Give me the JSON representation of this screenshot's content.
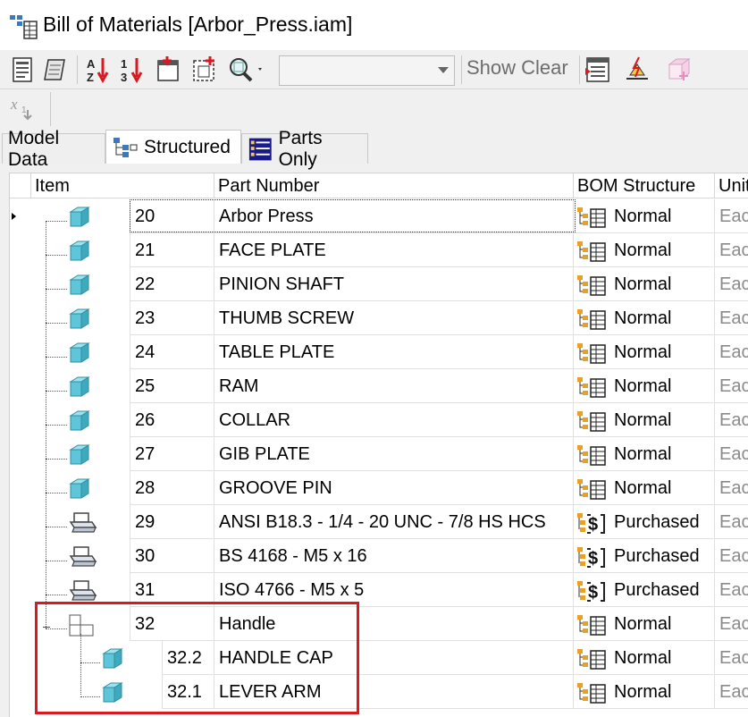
{
  "window": {
    "title": "Bill of Materials [Arbor_Press.iam]"
  },
  "toolbar": {
    "view_combo_value": "",
    "show_clear_label": "Show Clear"
  },
  "tabs": [
    {
      "label": "Model Data",
      "active": false
    },
    {
      "label": "Structured",
      "active": true
    },
    {
      "label": "Parts Only",
      "active": false
    }
  ],
  "grid": {
    "columns": {
      "item": "Item",
      "part_number": "Part Number",
      "bom_structure": "BOM Structure",
      "unit": "Unit"
    },
    "rows": [
      {
        "item": "20",
        "part_number": "Arbor Press",
        "bom": "Normal",
        "unit": "Each",
        "icon": "part-icon",
        "level": 0
      },
      {
        "item": "21",
        "part_number": "FACE PLATE",
        "bom": "Normal",
        "unit": "Each",
        "icon": "part-icon",
        "level": 0
      },
      {
        "item": "22",
        "part_number": "PINION SHAFT",
        "bom": "Normal",
        "unit": "Each",
        "icon": "part-icon",
        "level": 0
      },
      {
        "item": "23",
        "part_number": "THUMB SCREW",
        "bom": "Normal",
        "unit": "Each",
        "icon": "part-icon",
        "level": 0
      },
      {
        "item": "24",
        "part_number": "TABLE PLATE",
        "bom": "Normal",
        "unit": "Each",
        "icon": "part-icon",
        "level": 0
      },
      {
        "item": "25",
        "part_number": "RAM",
        "bom": "Normal",
        "unit": "Each",
        "icon": "part-icon",
        "level": 0
      },
      {
        "item": "26",
        "part_number": "COLLAR",
        "bom": "Normal",
        "unit": "Each",
        "icon": "part-icon",
        "level": 0
      },
      {
        "item": "27",
        "part_number": "GIB PLATE",
        "bom": "Normal",
        "unit": "Each",
        "icon": "part-icon",
        "level": 0
      },
      {
        "item": "28",
        "part_number": "GROOVE PIN",
        "bom": "Normal",
        "unit": "Each",
        "icon": "part-icon",
        "level": 0
      },
      {
        "item": "29",
        "part_number": "ANSI B18.3 - 1/4 - 20 UNC - 7/8 HS HCS",
        "bom": "Purchased",
        "unit": "Each",
        "icon": "content-center-icon",
        "level": 0
      },
      {
        "item": "30",
        "part_number": "BS 4168 - M5 x 16",
        "bom": "Purchased",
        "unit": "Each",
        "icon": "content-center-icon",
        "level": 0
      },
      {
        "item": "31",
        "part_number": "ISO 4766 - M5 x 5",
        "bom": "Purchased",
        "unit": "Each",
        "icon": "content-center-icon",
        "level": 0
      },
      {
        "item": "32",
        "part_number": "Handle",
        "bom": "Normal",
        "unit": "Each",
        "icon": "assembly-icon",
        "level": 0
      },
      {
        "item": "32.2",
        "part_number": "HANDLE CAP",
        "bom": "Normal",
        "unit": "Each",
        "icon": "part-icon",
        "level": 1
      },
      {
        "item": "32.1",
        "part_number": "LEVER ARM",
        "bom": "Normal",
        "unit": "Each",
        "icon": "part-icon",
        "level": 1
      }
    ]
  },
  "colors": {
    "highlight": "#d9191f",
    "part_blue": "#5ec6d8"
  }
}
